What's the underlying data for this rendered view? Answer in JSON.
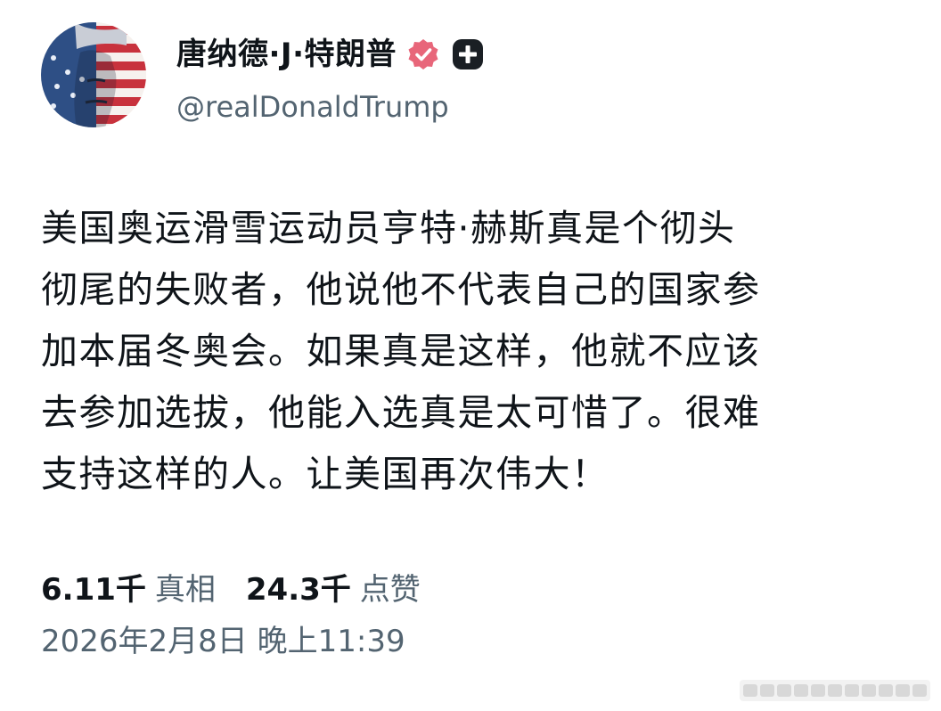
{
  "profile": {
    "display_name": "唐纳德·J·特朗普",
    "handle": "@realDonaldTrump",
    "verified_icon": "verified-badge-icon",
    "affiliate_icon": "plus-badge-icon"
  },
  "post": {
    "lines": [
      "美国奥运滑雪运动员亨特·赫斯真是个彻头",
      "彻尾的失败者，他说他不代表自己的国家参",
      "加本届冬奥会。如果真是这样，他就不应该",
      "去参加选拔，他能入选真是太可惜了。很难",
      "支持这样的人。让美国再次伟大！"
    ]
  },
  "stats": {
    "truths_value": "6.11千",
    "truths_label": "真相",
    "likes_value": "24.3千",
    "likes_label": "点赞"
  },
  "timestamp": "2026年2月8日 晚上11:39",
  "colors": {
    "text_primary": "#0f1419",
    "text_secondary": "#536471",
    "verified_badge": "#e8667a",
    "plus_badge": "#1a1f24"
  }
}
